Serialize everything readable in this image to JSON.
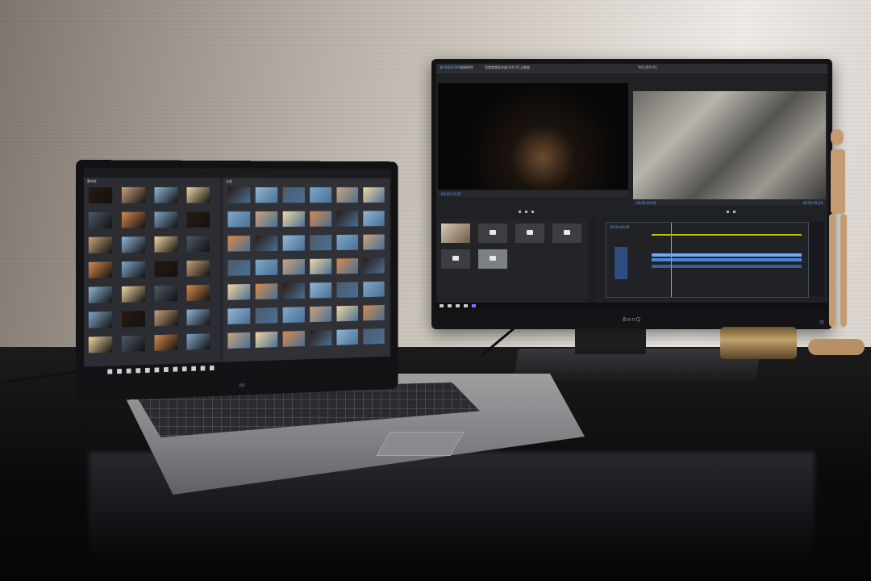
{
  "scene": {
    "description_free": true,
    "accent_color": "#5aa2ff",
    "wall_color": "#d8d2cb",
    "desk_color": "#0b0b0c"
  },
  "monitor": {
    "brand": "BenQ",
    "editor": {
      "menu_items": [
        "源:A003C006",
        "效果控件",
        "音频剪辑混合器:序列 01",
        "元数据"
      ],
      "program_tab": "节目:序列 01",
      "source_timecode": "00;00;13;26",
      "program_timecode": "00;00;44;06",
      "program_timecode_right": "00;00;59;26",
      "timeline_tab": "序列 01",
      "timeline_timecode": "00;00;44;06"
    }
  },
  "laptop": {
    "brand": "Mi",
    "sidebar_title": "素材库",
    "grid_title": "全部"
  }
}
